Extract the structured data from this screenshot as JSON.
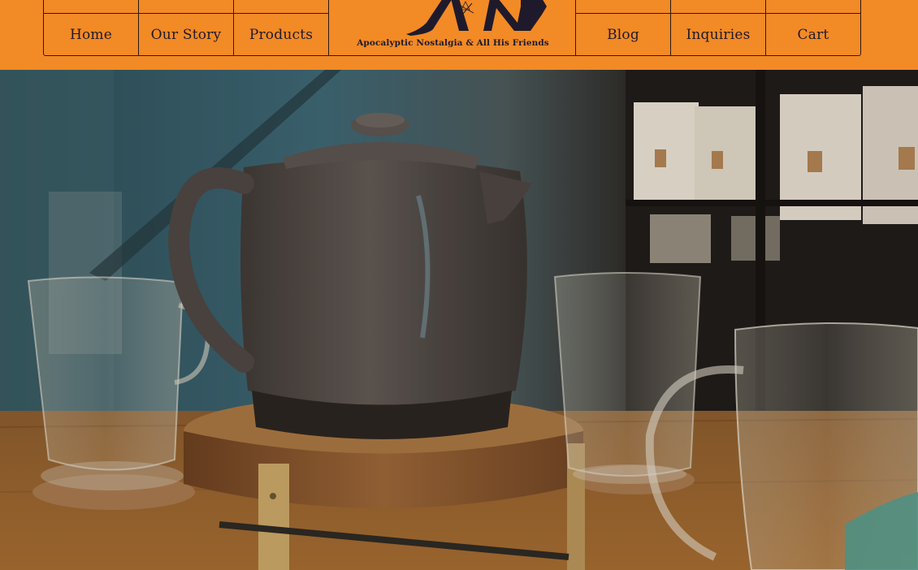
{
  "site": {
    "logo_text": "Apocalyptic Nostalgia & All His Friends",
    "logo_mark": "AN"
  },
  "nav": {
    "left": [
      {
        "label": "Home"
      },
      {
        "label": "Our Story"
      },
      {
        "label": "Products"
      }
    ],
    "right": [
      {
        "label": "Blog"
      },
      {
        "label": "Inquiries"
      },
      {
        "label": "Cart"
      }
    ]
  },
  "colors": {
    "header_bg": "#f28a26",
    "nav_text": "#1f1a2b",
    "border": "#2a1a17"
  },
  "hero": {
    "image_subject": "teapot-and-glass-mugs-photo"
  }
}
